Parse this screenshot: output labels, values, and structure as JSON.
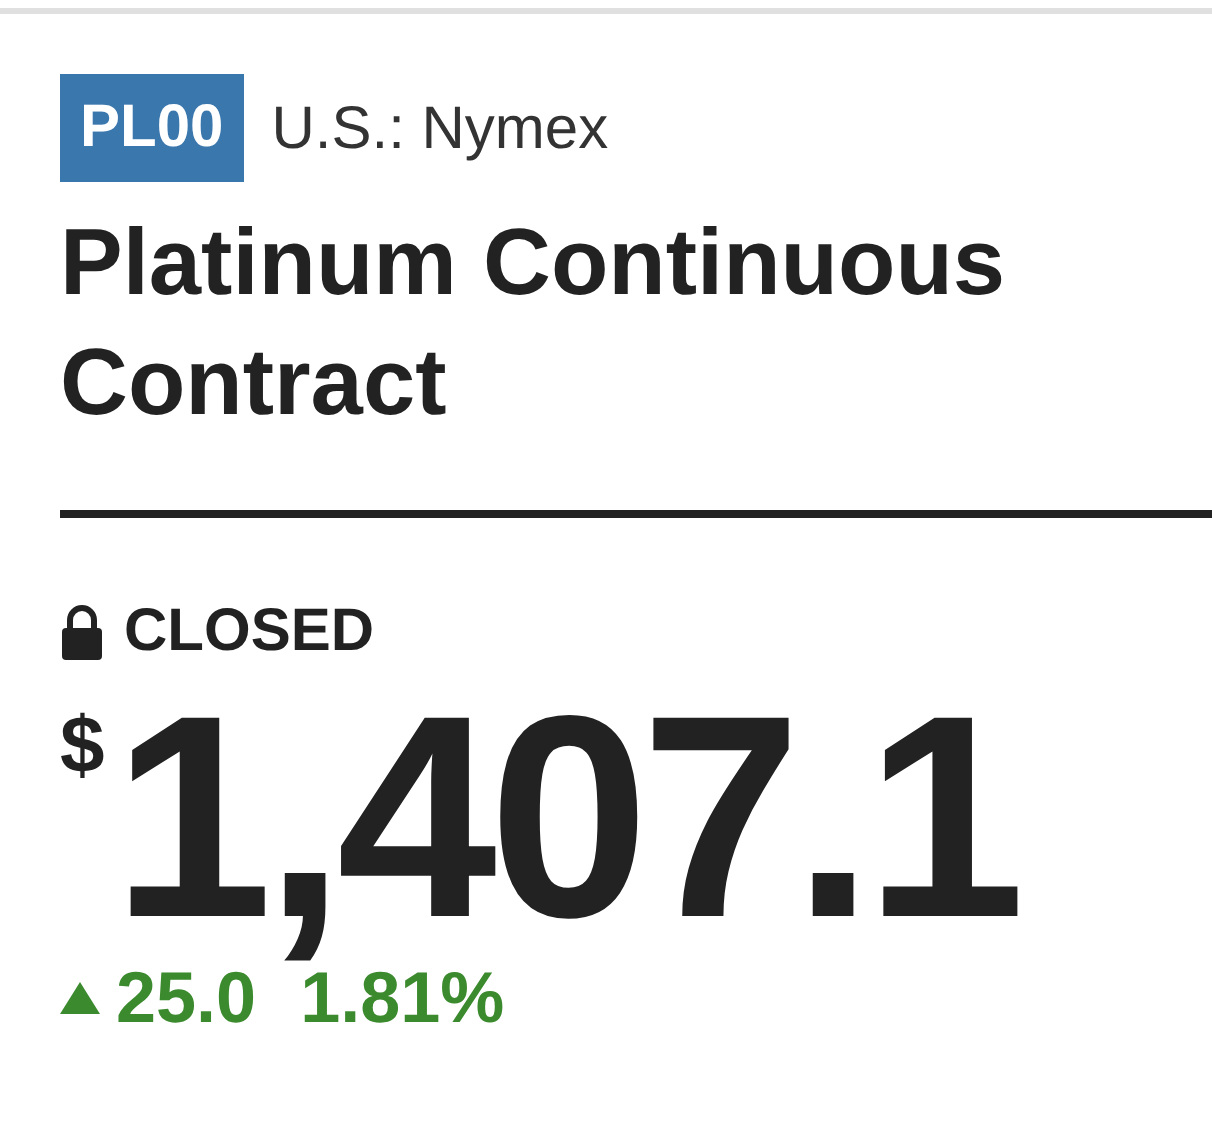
{
  "exchange_badge": "PL00",
  "exchange": "U.S.: Nymex",
  "title": "Platinum Continuous Contract",
  "market_status": {
    "label": "CLOSED",
    "kind": "closed"
  },
  "price": {
    "currency": "$",
    "value": "1,407.1"
  },
  "change": {
    "positive": true,
    "amount": "25.0",
    "percent": "1.81%"
  }
}
